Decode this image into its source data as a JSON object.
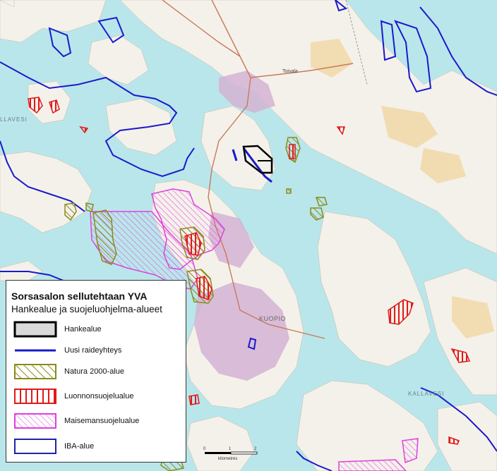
{
  "legend": {
    "title": "Sorsasalon sellutehtaan YVA",
    "subtitle": "Hankealue ja suojeluohjelma-alueet",
    "items": [
      {
        "label": "Hankealue",
        "style": "project-area",
        "stroke": "#000000",
        "fill": "#d9d9d9"
      },
      {
        "label": "Uusi raideyhteys",
        "style": "line",
        "stroke": "#1a1acc"
      },
      {
        "label": "Natura 2000-alue",
        "style": "diagonal-hatch",
        "stroke": "#8b8b1a"
      },
      {
        "label": "Luonnonsuojelualue",
        "style": "vertical-hatch",
        "stroke": "#e01a1a"
      },
      {
        "label": "Maisemansuojelualue",
        "style": "diagonal-hatch",
        "stroke": "#e040e0"
      },
      {
        "label": "IBA-alue",
        "style": "outline",
        "stroke": "#2222aa"
      }
    ]
  },
  "map_labels": {
    "city": "KUOPIO",
    "lake": "KALLAVESI",
    "lake_west": "LLAVESI",
    "village": "Toivala"
  },
  "scale": {
    "ticks": [
      "0",
      "1",
      "2"
    ],
    "unit": "kilometres"
  },
  "colors": {
    "water": "#b9e6ea",
    "land": "#f3efe6",
    "forest": "#ffffff",
    "urban": "#c9a9c9",
    "field": "#f1d7a3",
    "road": "#c77a5a"
  }
}
